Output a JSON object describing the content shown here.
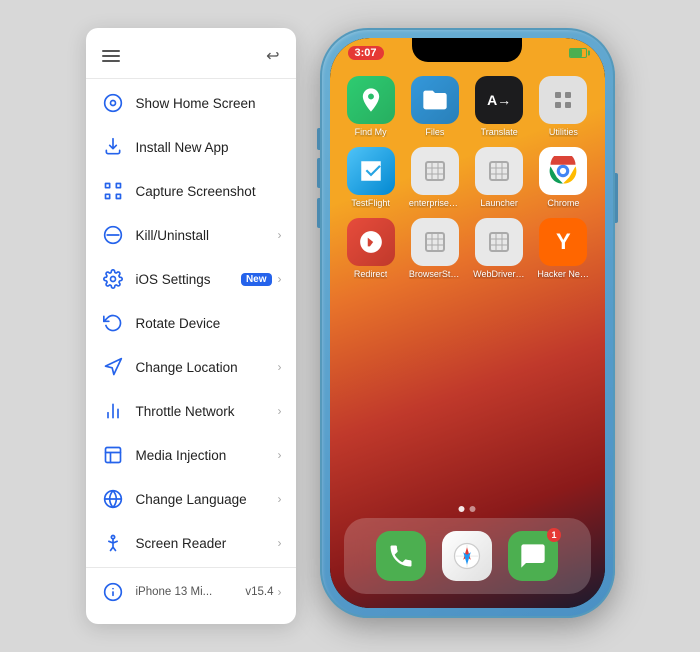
{
  "sidebar": {
    "items": [
      {
        "id": "show-home",
        "label": "Show Home Screen",
        "icon": "home",
        "hasArrow": false
      },
      {
        "id": "install-app",
        "label": "Install New App",
        "icon": "install",
        "hasArrow": false
      },
      {
        "id": "capture",
        "label": "Capture Screenshot",
        "icon": "screenshot",
        "hasArrow": false
      },
      {
        "id": "kill",
        "label": "Kill/Uninstall",
        "icon": "kill",
        "hasArrow": true
      },
      {
        "id": "ios-settings",
        "label": "iOS Settings",
        "icon": "settings",
        "hasArrow": true,
        "badge": "New"
      },
      {
        "id": "rotate",
        "label": "Rotate Device",
        "icon": "rotate",
        "hasArrow": false
      },
      {
        "id": "location",
        "label": "Change Location",
        "icon": "location",
        "hasArrow": true
      },
      {
        "id": "throttle",
        "label": "Throttle Network",
        "icon": "network",
        "hasArrow": true
      },
      {
        "id": "media",
        "label": "Media Injection",
        "icon": "media",
        "hasArrow": true
      },
      {
        "id": "language",
        "label": "Change Language",
        "icon": "language",
        "hasArrow": true
      },
      {
        "id": "reader",
        "label": "Screen Reader",
        "icon": "accessibility",
        "hasArrow": true
      }
    ],
    "device": {
      "label": "iPhone 13 Mi...",
      "version": "v15.4"
    }
  },
  "phone": {
    "status_time": "3:07",
    "apps": [
      {
        "name": "Find My",
        "color": "findmy"
      },
      {
        "name": "Files",
        "color": "files"
      },
      {
        "name": "Translate",
        "color": "translate"
      },
      {
        "name": "Utilities",
        "color": "utilities"
      },
      {
        "name": "TestFlight",
        "color": "testflight"
      },
      {
        "name": "enterpriseDum...",
        "color": "enterprise"
      },
      {
        "name": "Launcher",
        "color": "launcher"
      },
      {
        "name": "Chrome",
        "color": "chrome"
      },
      {
        "name": "Redirect",
        "color": "redirect"
      },
      {
        "name": "BrowserStack",
        "color": "browserstack"
      },
      {
        "name": "WebDriverAge...",
        "color": "webdriver"
      },
      {
        "name": "Hacker News",
        "color": "hackernews"
      }
    ],
    "dock": [
      {
        "name": "Phone",
        "color": "phone",
        "badge": null
      },
      {
        "name": "Safari",
        "color": "safari",
        "badge": null
      },
      {
        "name": "Messages",
        "color": "messages",
        "badge": "1"
      }
    ]
  }
}
